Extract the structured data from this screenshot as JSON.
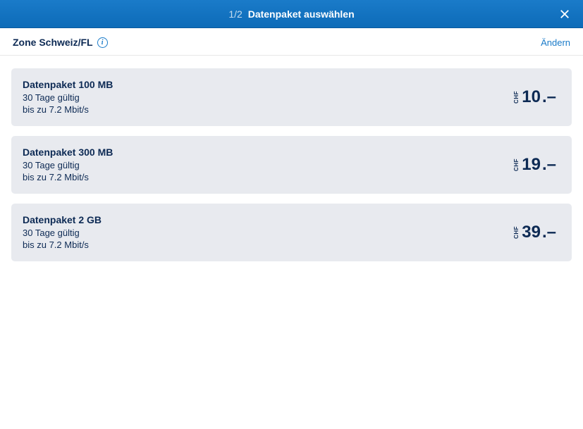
{
  "header": {
    "step": "1/2",
    "title": "Datenpaket auswählen"
  },
  "zone": {
    "label": "Zone Schweiz/FL",
    "change_link": "Ändern"
  },
  "packages": [
    {
      "name": "Datenpaket 100 MB",
      "validity": "30 Tage gültig",
      "speed": "bis zu 7.2 Mbit/s",
      "currency": "CHF",
      "amount": "10",
      "suffix": ".–"
    },
    {
      "name": "Datenpaket 300 MB",
      "validity": "30 Tage gültig",
      "speed": "bis zu 7.2 Mbit/s",
      "currency": "CHF",
      "amount": "19",
      "suffix": ".–"
    },
    {
      "name": "Datenpaket 2 GB",
      "validity": "30 Tage gültig",
      "speed": "bis zu 7.2 Mbit/s",
      "currency": "CHF",
      "amount": "39",
      "suffix": ".–"
    }
  ]
}
